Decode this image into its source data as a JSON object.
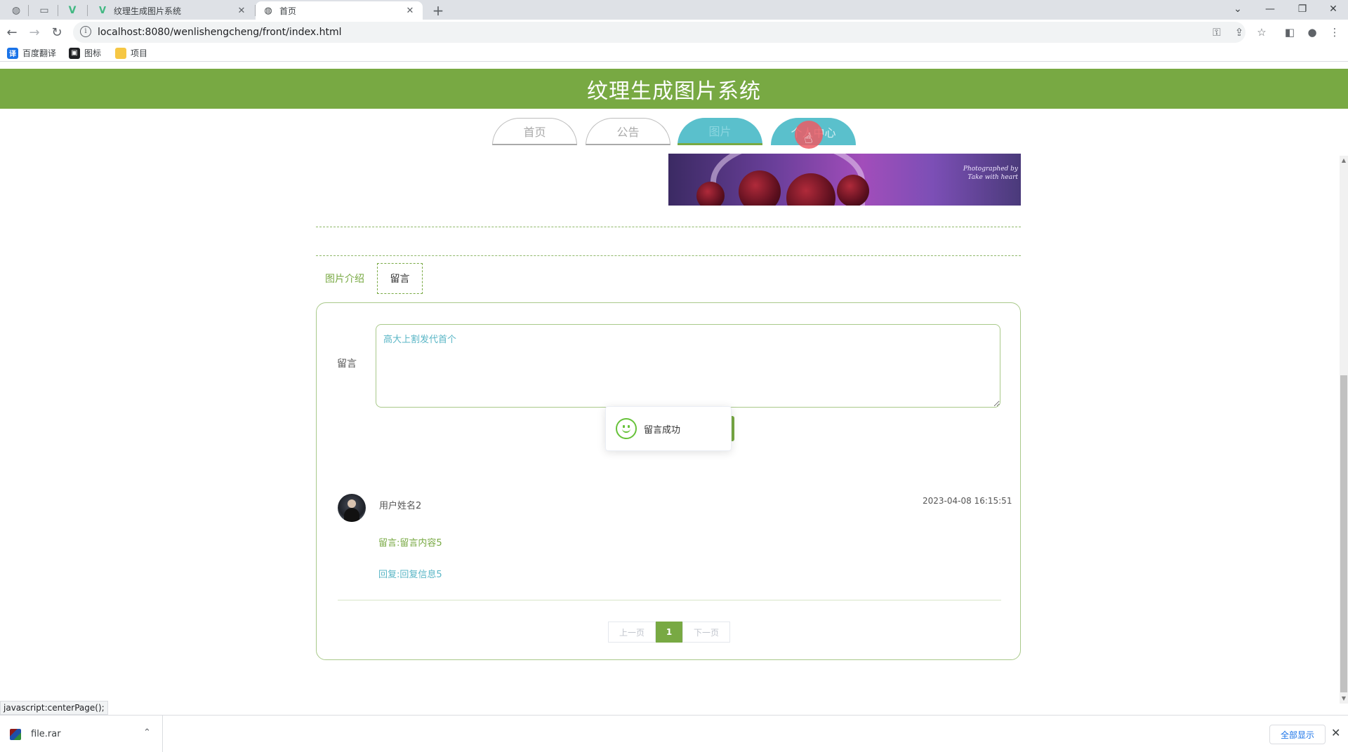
{
  "browser": {
    "tabs": [
      {
        "title": "纹理生成图片系统",
        "close": "✕"
      },
      {
        "title": "首页",
        "close": "✕"
      }
    ],
    "new_tab": "+",
    "window_controls": [
      "⌄",
      "—",
      "❐",
      "✕"
    ],
    "url": "localhost:8080/wenlishengcheng/front/index.html",
    "bookmarks": [
      {
        "label": "百度翻译",
        "icon": "translate-icon",
        "color": "#1a73e8"
      },
      {
        "label": "图标",
        "icon": "image-icon",
        "color": "#202124"
      },
      {
        "label": "项目",
        "icon": "folder-icon",
        "color": "#f6c744"
      }
    ]
  },
  "site": {
    "title": "纹理生成图片系统",
    "accent": "#78a943",
    "secondary": "#5ac0cc"
  },
  "nav": [
    {
      "label": "首页",
      "state": "default"
    },
    {
      "label": "公告",
      "state": "default"
    },
    {
      "label": "图片",
      "state": "active"
    },
    {
      "label": "个人中心",
      "state": "hover"
    }
  ],
  "banner": {
    "credit": "Photographed by\nTake with heart"
  },
  "detail_tabs": {
    "intro": "图片介绍",
    "message": "留言"
  },
  "form": {
    "label": "留言",
    "textarea_value": "高大上割发代首个"
  },
  "toast": {
    "text": "留言成功"
  },
  "comments": [
    {
      "username": "用户姓名2",
      "timestamp": "2023-04-08 16:15:51",
      "content": "留言:留言内容5",
      "reply": "回复:回复信息5"
    }
  ],
  "pagination": {
    "prev": "上一页",
    "current": "1",
    "next": "下一页"
  },
  "status_bar": {
    "url": "javascript:centerPage();"
  },
  "downloads": {
    "file": "file.rar",
    "show_all": "全部显示"
  }
}
